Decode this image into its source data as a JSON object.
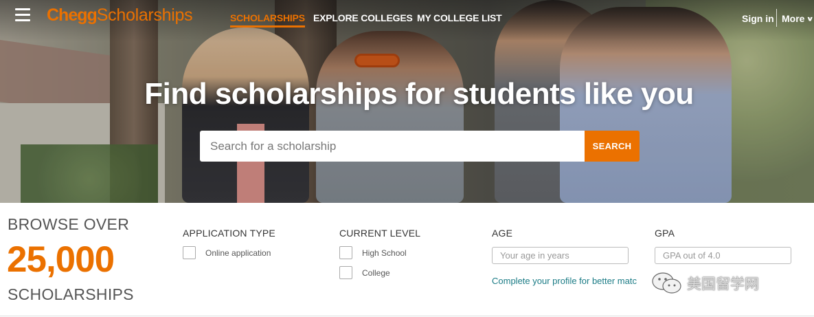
{
  "nav": {
    "logo_brand": "Chegg",
    "logo_product": "Scholarships",
    "links": [
      {
        "label": "SCHOLARSHIPS",
        "active": true
      },
      {
        "label": "EXPLORE COLLEGES",
        "active": false
      },
      {
        "label": "MY COLLEGE LIST",
        "active": false
      }
    ],
    "sign_in": "Sign in",
    "more": "More",
    "brand_color": "#eb7100"
  },
  "hero": {
    "headline": "Find scholarships for students like you",
    "search_placeholder": "Search for a scholarship",
    "search_button": "SEARCH"
  },
  "stats": {
    "browse_over": "BROWSE OVER",
    "count": "25,000",
    "scholarships": "SCHOLARSHIPS"
  },
  "filters": {
    "application_type": {
      "title": "APPLICATION TYPE",
      "options": [
        "Online application"
      ]
    },
    "current_level": {
      "title": "CURRENT LEVEL",
      "options": [
        "High School",
        "College"
      ]
    },
    "age": {
      "title": "AGE",
      "placeholder": "Your age in years"
    },
    "gpa": {
      "title": "GPA",
      "placeholder": "GPA out of 4.0"
    },
    "profile_link": "Complete your profile for better matc"
  },
  "watermark": {
    "text": "美国留学网",
    "icon": "wechat-icon"
  },
  "icons": {
    "menu": "hamburger-menu-icon",
    "more": "chevron-down-icon"
  }
}
